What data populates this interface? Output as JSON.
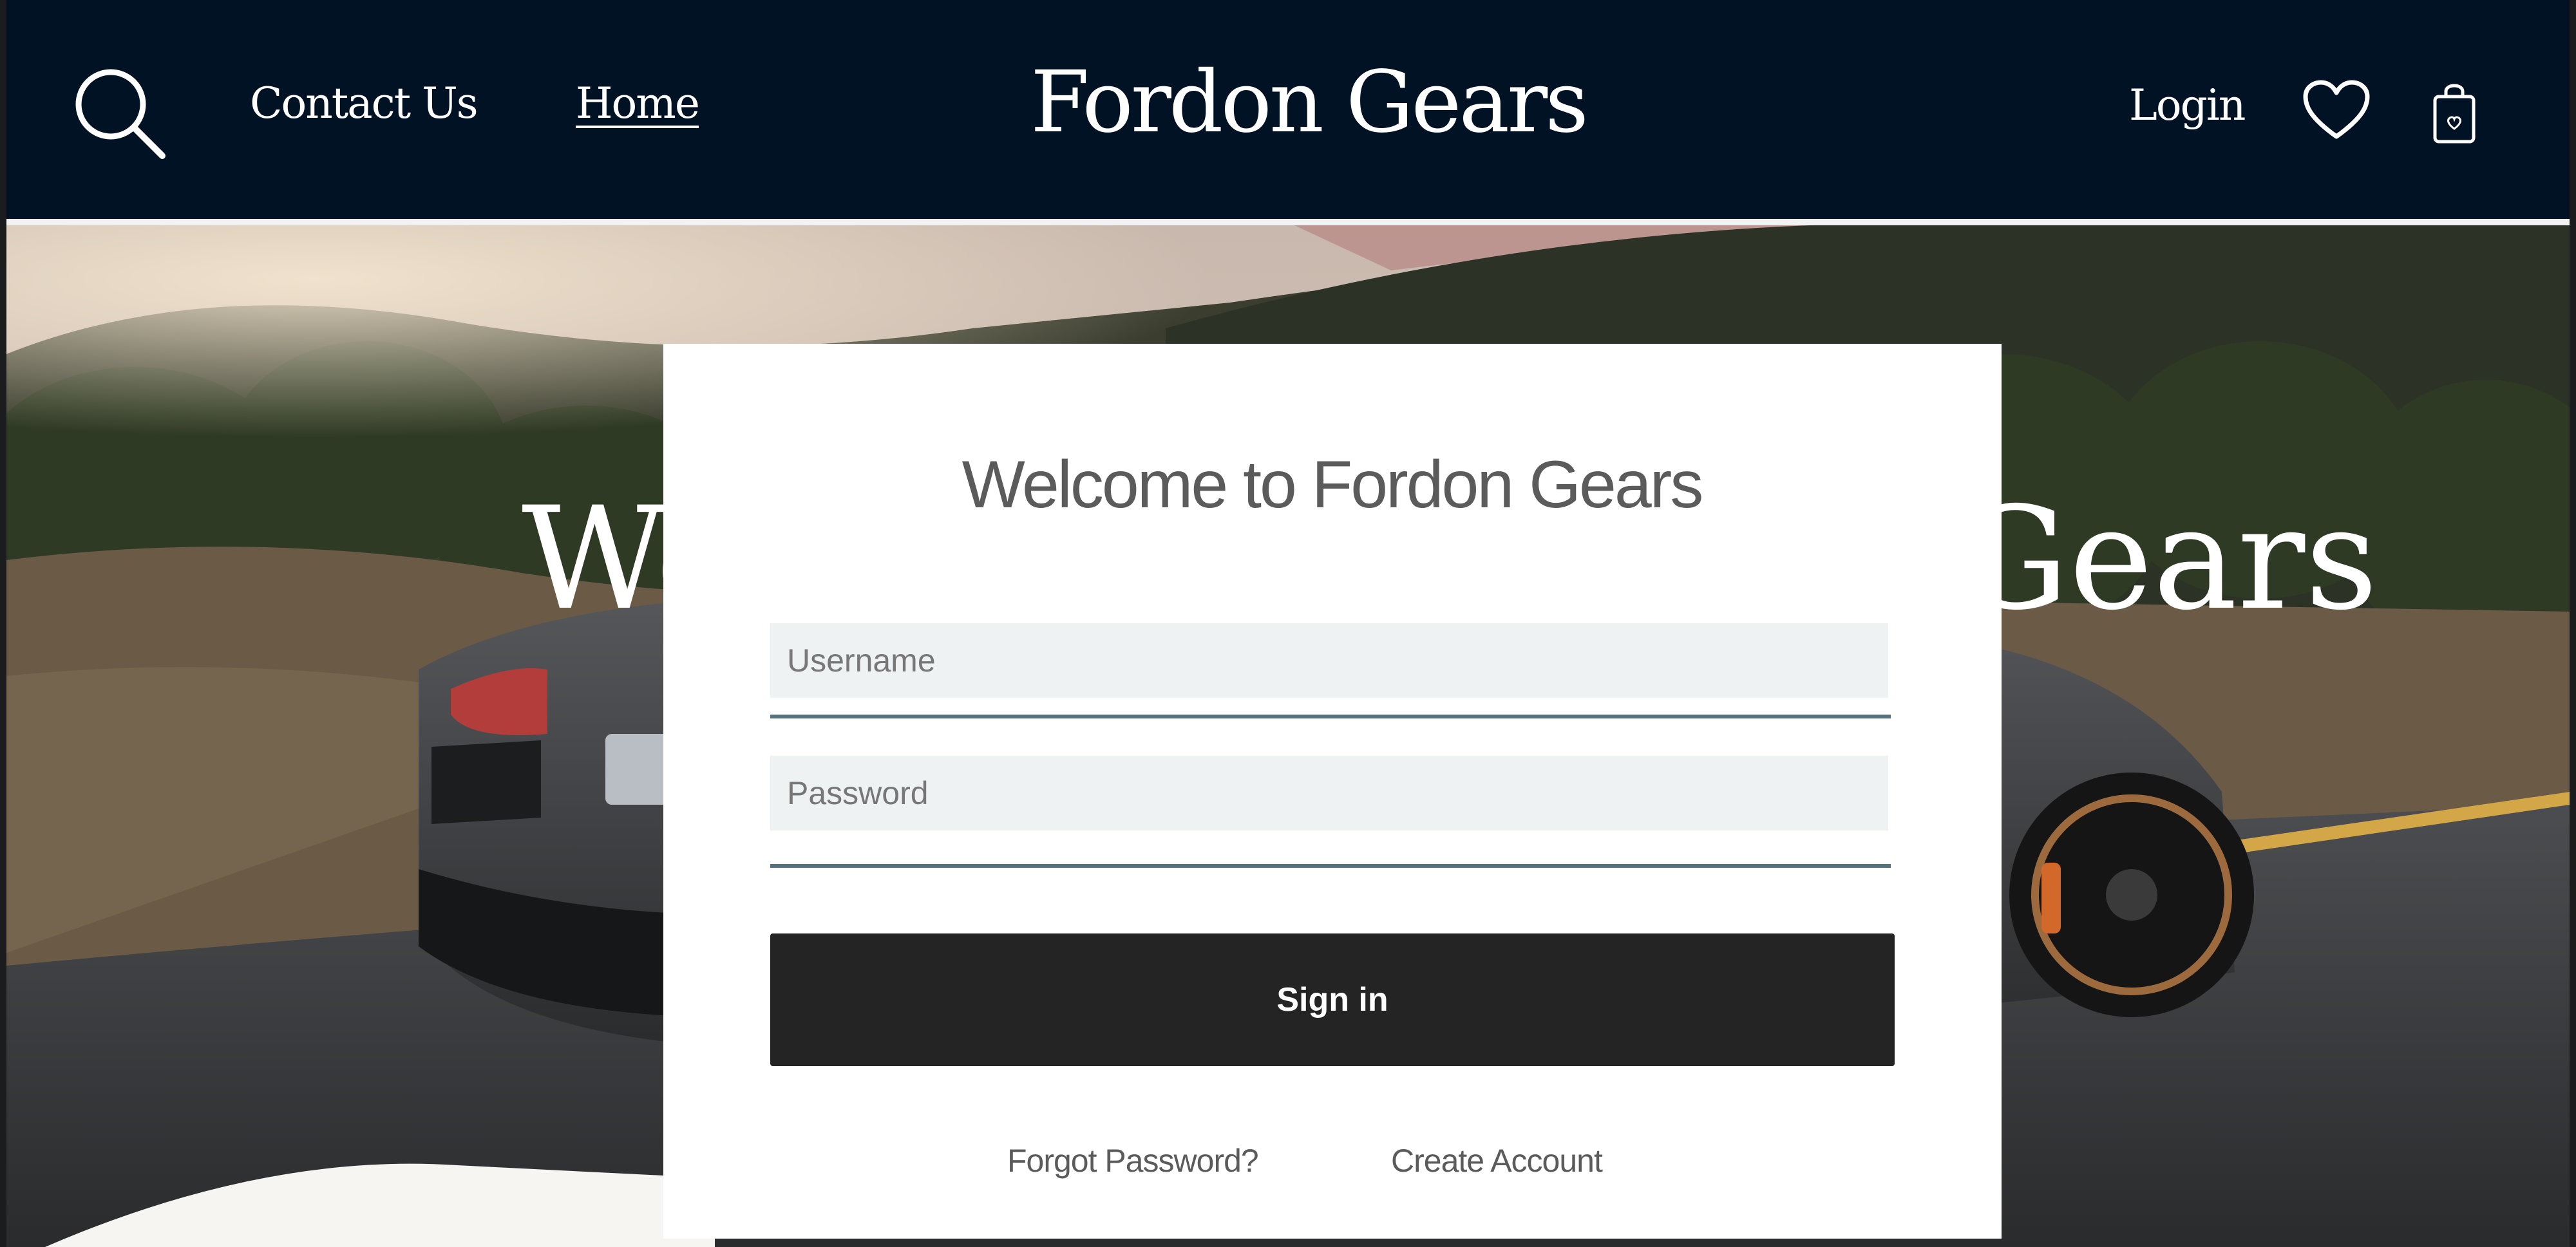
{
  "header": {
    "contact_label": "Contact Us",
    "home_label": "Home",
    "brand": "Fordon Gears",
    "login_label": "Login",
    "icons": [
      "search-icon",
      "heart-icon",
      "shopping-bag-icon"
    ],
    "background_color": "#011224"
  },
  "hero": {
    "title": "Welcome to Fordon Gears",
    "image": "grey sports car on a mountain road at dusk"
  },
  "login": {
    "title": "Welcome to Fordon Gears",
    "username_placeholder": "Username",
    "username_value": "",
    "password_placeholder": "Password",
    "password_value": "",
    "signin_label": "Sign in",
    "forgot_label": "Forgot Password?",
    "create_label": "Create Account",
    "button_color": "#242424",
    "field_color": "#eff2f3",
    "underline_color": "#557180"
  }
}
